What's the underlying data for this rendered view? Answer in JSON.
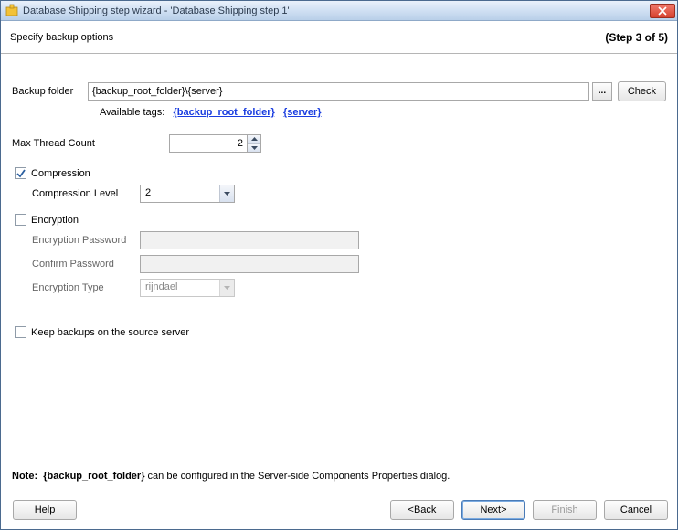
{
  "title": "Database Shipping step wizard - 'Database Shipping step 1'",
  "subheader": "Specify backup options",
  "step_label": "(Step 3 of 5)",
  "backup_folder": {
    "label": "Backup folder",
    "value": "{backup_root_folder}\\{server}",
    "check_label": "Check",
    "browse_label": "...",
    "tags_label": "Available tags:",
    "tag1": "{backup_root_folder}",
    "tag2": "{server}"
  },
  "max_thread": {
    "label": "Max Thread Count",
    "value": "2"
  },
  "compression": {
    "label": "Compression",
    "checked": true,
    "level_label": "Compression Level",
    "level_value": "2"
  },
  "encryption": {
    "label": "Encryption",
    "checked": false,
    "password_label": "Encryption Password",
    "confirm_label": "Confirm Password",
    "type_label": "Encryption Type",
    "type_value": "rijndael"
  },
  "keep_backups": {
    "label": "Keep backups on the source server",
    "checked": false
  },
  "note": {
    "prefix": "Note:",
    "bold": "{backup_root_folder}",
    "rest": " can be configured in the Server-side Components Properties dialog."
  },
  "buttons": {
    "help": "Help",
    "back": "<Back",
    "next": "Next>",
    "finish": "Finish",
    "cancel": "Cancel"
  }
}
